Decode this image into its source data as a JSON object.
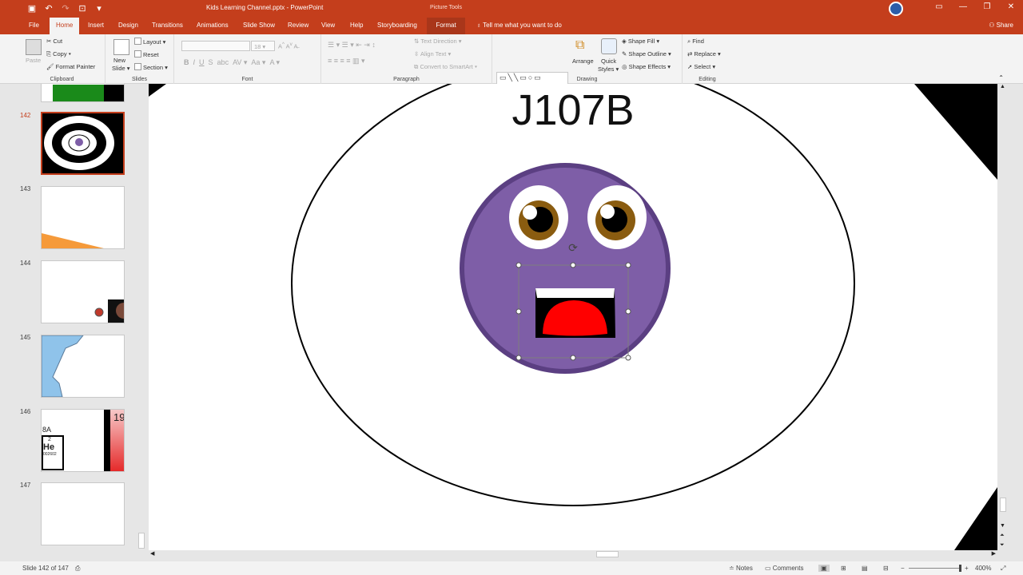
{
  "window": {
    "title": "Kids Learning Channel.pptx  -  PowerPoint",
    "context_title": "Picture Tools"
  },
  "tabs": [
    "File",
    "Home",
    "Insert",
    "Design",
    "Transitions",
    "Animations",
    "Slide Show",
    "Review",
    "View",
    "Help",
    "Storyboarding"
  ],
  "context_tab": "Format",
  "tell_me": "Tell me what you want to do",
  "share": "Share",
  "ribbon": {
    "clipboard": {
      "label": "Clipboard",
      "paste": "Paste",
      "cut": "Cut",
      "copy": "Copy",
      "format_painter": "Format Painter"
    },
    "slides": {
      "label": "Slides",
      "new_slide": "New",
      "new_slide2": "Slide",
      "layout": "Layout",
      "reset": "Reset",
      "section": "Section"
    },
    "font": {
      "label": "Font",
      "size": "18"
    },
    "paragraph": {
      "label": "Paragraph",
      "text_direction": "Text Direction",
      "align_text": "Align Text",
      "convert": "Convert to SmartArt"
    },
    "drawing": {
      "label": "Drawing",
      "arrange": "Arrange",
      "quick_styles": "Quick",
      "quick_styles2": "Styles",
      "shape_fill": "Shape Fill",
      "shape_outline": "Shape Outline",
      "shape_effects": "Shape Effects"
    },
    "editing": {
      "label": "Editing",
      "find": "Find",
      "replace": "Replace",
      "select": "Select"
    }
  },
  "thumbnails": [
    {
      "num": "142",
      "selected": true
    },
    {
      "num": "143"
    },
    {
      "num": "144"
    },
    {
      "num": "145"
    },
    {
      "num": "146",
      "text_group": "8A",
      "text_number": "2",
      "text_symbol": "He",
      "text_mass": "002602",
      "text_side": "19"
    },
    {
      "num": "147"
    }
  ],
  "slide": {
    "title": "J107B"
  },
  "status": {
    "slide_info": "Slide 142 of 147",
    "notes": "Notes",
    "comments": "Comments",
    "zoom": "400%"
  },
  "colors": {
    "accent": "#c43e1c",
    "face": "#7e5ea7",
    "face_border": "#5b3f82",
    "mouth": "#ff0000",
    "iris": "#8a5c10"
  }
}
